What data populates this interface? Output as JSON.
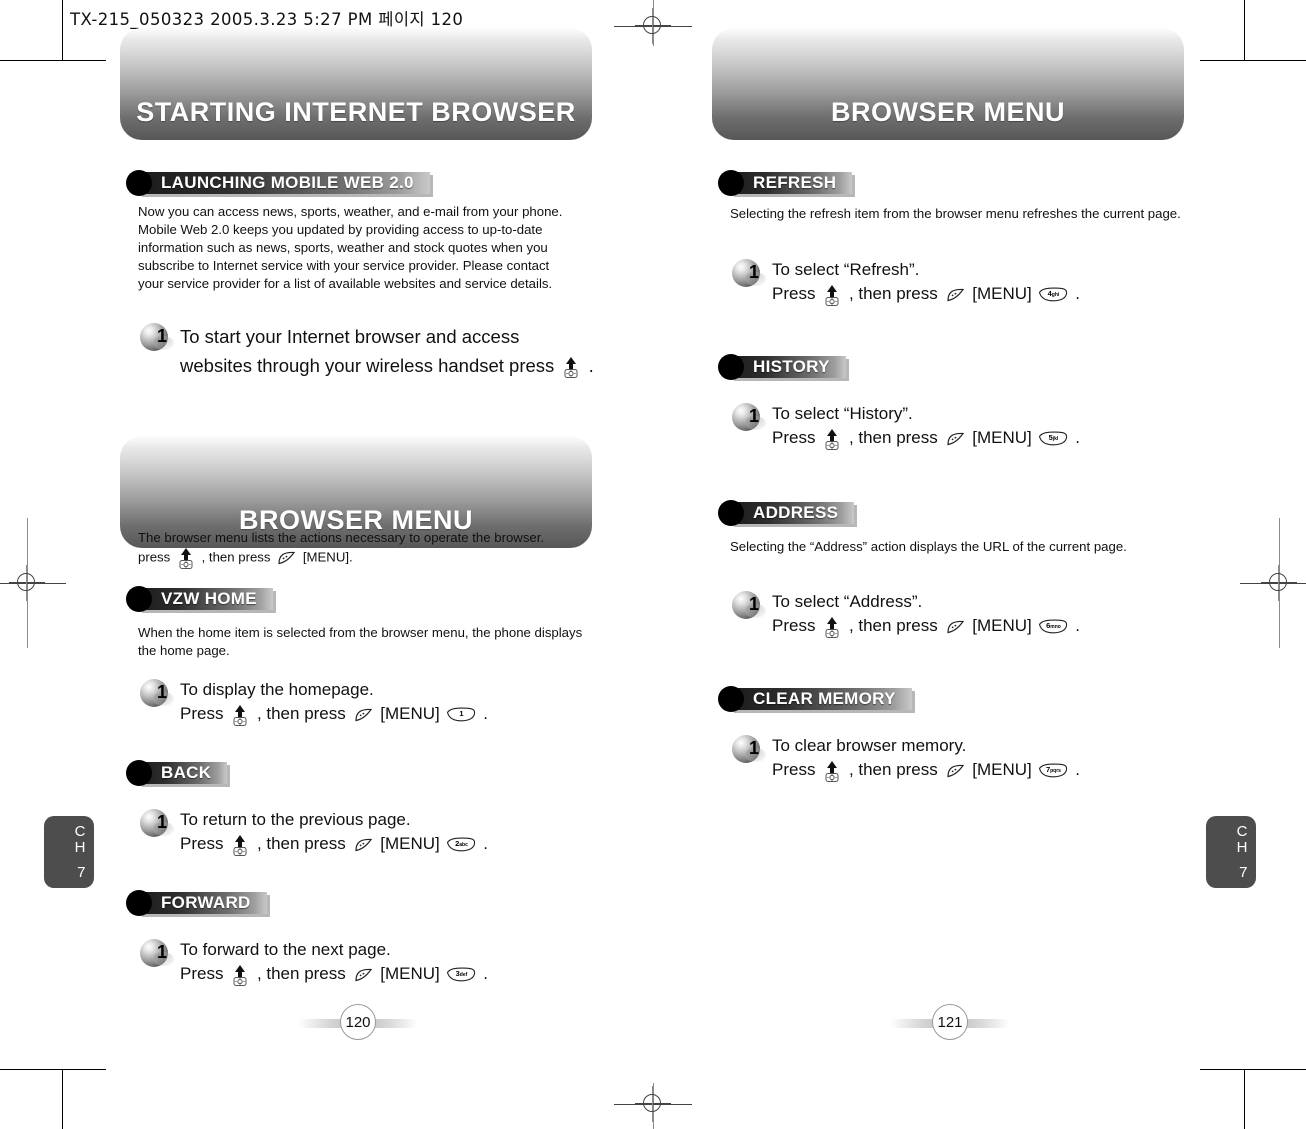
{
  "slug": "TX-215_050323  2005.3.23 5:27 PM  페이지 120",
  "chapter_tab": {
    "ch_line1": "C",
    "ch_line2": "H",
    "number": "7"
  },
  "icons": {
    "nav": "nav-up-key-icon",
    "softkey": "soft-key-icon",
    "numkey": "number-key-icon"
  },
  "left_page": {
    "page_number": "120",
    "banner_title": "STARTING INTERNET BROWSER",
    "section_launching": {
      "heading": "LAUNCHING MOBILE WEB 2.0",
      "body": "Now you can access news, sports, weather, and e-mail from your phone. Mobile Web 2.0 keeps you updated by providing access to up-to-date information such as news, sports, weather and stock quotes when you subscribe to Internet service with your service provider. Please contact your service provider for a list of available websites and service details.",
      "step_number": "1",
      "step_line1": "To start your Internet browser and access",
      "step_line2_a": "websites through your wireless handset press",
      "step_line2_b": "."
    },
    "banner_title2": "BROWSER MENU",
    "browser_menu_intro_a": "The browser menu lists the actions necessary to operate the browser.",
    "browser_menu_intro_b": "press",
    "browser_menu_intro_c": ", then press",
    "browser_menu_intro_d": "[MENU].",
    "section_vzw_home": {
      "heading": "VZW HOME",
      "body": "When the home item is selected from the browser menu, the phone displays the home page.",
      "step_number": "1",
      "step_line1": "To display the homepage.",
      "press": "Press",
      "then_press": ", then press",
      "menu": "[MENU]",
      "key_digit": "1",
      "key_letters": "",
      "period": "."
    },
    "section_back": {
      "heading": "BACK",
      "step_number": "1",
      "step_line1": "To return to the previous page.",
      "press": "Press",
      "then_press": ", then press",
      "menu": "[MENU]",
      "key_digit": "2",
      "key_letters": "abc",
      "period": "."
    },
    "section_forward": {
      "heading": "FORWARD",
      "step_number": "1",
      "step_line1": "To forward to the next page.",
      "press": "Press",
      "then_press": ", then press",
      "menu": "[MENU]",
      "key_digit": "3",
      "key_letters": "def",
      "period": "."
    }
  },
  "right_page": {
    "page_number": "121",
    "banner_title": "BROWSER MENU",
    "section_refresh": {
      "heading": "REFRESH",
      "body": "Selecting the refresh item from the browser menu refreshes the current page.",
      "step_number": "1",
      "step_line1": "To select “Refresh”.",
      "press": "Press",
      "then_press": ", then press",
      "menu": "[MENU]",
      "key_digit": "4",
      "key_letters": "ghi",
      "period": "."
    },
    "section_history": {
      "heading": "HISTORY",
      "step_number": "1",
      "step_line1": "To select “History”.",
      "press": "Press",
      "then_press": ", then press",
      "menu": "[MENU]",
      "key_digit": "5",
      "key_letters": "jkl",
      "period": "."
    },
    "section_address": {
      "heading": "ADDRESS",
      "body": "Selecting the “Address” action displays the URL of the current page.",
      "step_number": "1",
      "step_line1": "To select “Address”.",
      "press": "Press",
      "then_press": ", then press",
      "menu": "[MENU]",
      "key_digit": "6",
      "key_letters": "mno",
      "period": "."
    },
    "section_clear_memory": {
      "heading": "CLEAR MEMORY",
      "step_number": "1",
      "step_line1": "To clear browser memory.",
      "press": "Press",
      "then_press": ", then press",
      "menu": "[MENU]",
      "key_digit": "7",
      "key_letters": "pqrs",
      "period": "."
    }
  }
}
